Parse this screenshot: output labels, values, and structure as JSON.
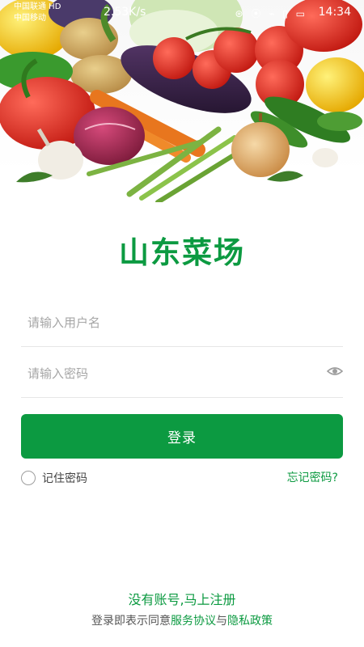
{
  "status_bar": {
    "carrier1": "中国联通 HD",
    "carrier2": "中国移动",
    "net_speed": "2.53K/s",
    "time": "14:34",
    "icons": "⊛ ⦿ ⌁ ▯ ▭"
  },
  "app": {
    "title": "山东菜场",
    "brand_color": "#0c9a41"
  },
  "login_form": {
    "username_placeholder": "请输入用户名",
    "password_placeholder": "请输入密码",
    "login_button": "登录",
    "remember_label": "记住密码",
    "forgot_link": "忘记密码?"
  },
  "footer": {
    "register_link": "没有账号,马上注册",
    "agreement_prefix": "登录即表示同意",
    "service_link": "服务协议",
    "and": "与",
    "privacy_link": "隐私政策"
  }
}
